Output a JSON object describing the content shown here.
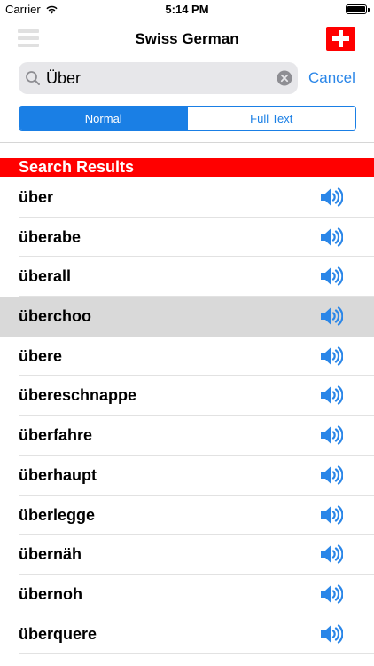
{
  "status_bar": {
    "carrier": "Carrier",
    "time": "5:14 PM"
  },
  "nav": {
    "title": "Swiss German",
    "flag_icon": "swiss-flag-icon"
  },
  "search": {
    "value": "Über",
    "cancel_label": "Cancel"
  },
  "segments": [
    {
      "label": "Normal",
      "active": true
    },
    {
      "label": "Full Text",
      "active": false
    }
  ],
  "section_header": "Search Results",
  "results": [
    {
      "word": "über"
    },
    {
      "word": "überabe"
    },
    {
      "word": "überall"
    },
    {
      "word": "überchoo",
      "selected": true
    },
    {
      "word": "übere"
    },
    {
      "word": "übereschnappe"
    },
    {
      "word": "überfahre"
    },
    {
      "word": "überhaupt"
    },
    {
      "word": "überlegge"
    },
    {
      "word": "übernäh"
    },
    {
      "word": "übernoh"
    },
    {
      "word": "überquere"
    }
  ],
  "colors": {
    "accent": "#1a7fe5",
    "header_red": "#ff0000",
    "speaker_blue": "#2a86e8"
  }
}
